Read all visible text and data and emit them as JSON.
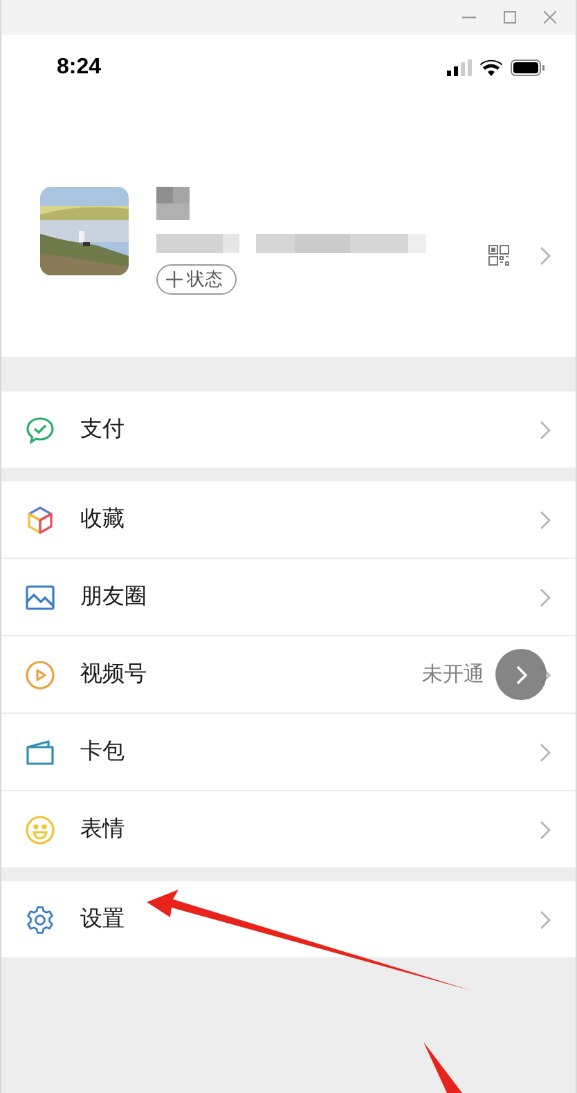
{
  "status_bar": {
    "time": "8:24"
  },
  "profile": {
    "status_button": "状态"
  },
  "groups": [
    [
      {
        "kind": "pay",
        "label": "支付"
      }
    ],
    [
      {
        "kind": "favorites",
        "label": "收藏"
      },
      {
        "kind": "moments",
        "label": "朋友圈"
      },
      {
        "kind": "channels",
        "label": "视频号",
        "value": "未开通"
      },
      {
        "kind": "cards",
        "label": "卡包"
      },
      {
        "kind": "stickers",
        "label": "表情"
      }
    ],
    [
      {
        "kind": "settings",
        "label": "设置"
      }
    ]
  ]
}
